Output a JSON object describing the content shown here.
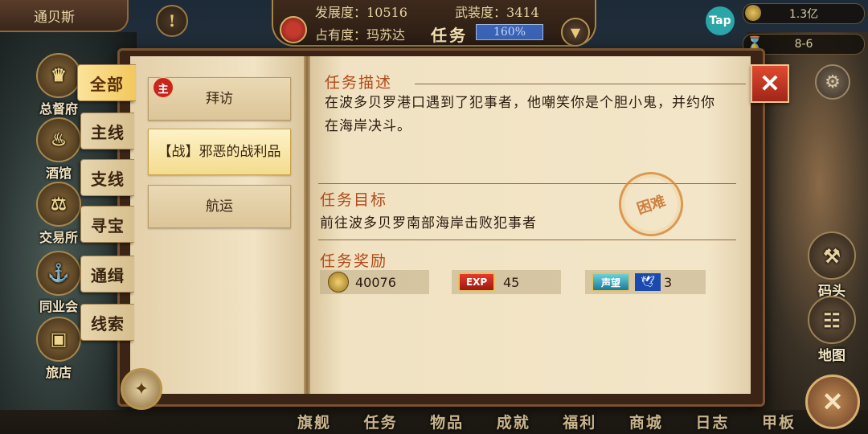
{
  "top_bar": {
    "city_name": "通贝斯",
    "development_label": "发展度：",
    "development_value": "10516",
    "military_label": "武装度：",
    "military_value": "3414",
    "occupancy_label": "占有度：",
    "occupancy_value": "玛苏达",
    "current_screen": "任务",
    "progress_text": "160%",
    "progress_fraction": 1.0,
    "tap_icon": "Tap",
    "currency_value": "1.3亿",
    "date_value": "8-6"
  },
  "left_buildings": [
    {
      "label": "总督府",
      "icon": "crown-icon"
    },
    {
      "label": "酒馆",
      "icon": "chef-icon"
    },
    {
      "label": "交易所",
      "icon": "scales-icon"
    },
    {
      "label": "同业会",
      "icon": "anchor-icon"
    },
    {
      "label": "旅店",
      "icon": "chest-icon"
    }
  ],
  "categories": [
    "全部",
    "主线",
    "支线",
    "寻宝",
    "通缉",
    "线索"
  ],
  "active_category": "全部",
  "quests": [
    {
      "label": "拜访",
      "badge": "主"
    },
    {
      "label": "【战】邪恶的战利品",
      "active": true
    },
    {
      "label": "航运"
    }
  ],
  "detail": {
    "description_title": "任务描述",
    "description_text": "在波多贝罗港口遇到了犯事者，他嘲笑你是个胆小鬼，并约你在海岸决斗。",
    "goal_title": "任务目标",
    "goal_text": "前往波多贝罗南部海岸击败犯事者",
    "difficulty_stamp": "困难",
    "reward_title": "任务奖励",
    "rewards": [
      {
        "icon": "gold-coin-icon",
        "value": "40076"
      },
      {
        "icon": "exp-icon",
        "icon_text": "EXP",
        "value": "45"
      },
      {
        "icon": "reputation-icon",
        "icon_text": "声望",
        "value": "3"
      }
    ]
  },
  "right_buttons": [
    {
      "label": "码头",
      "icon": "dock-icon"
    },
    {
      "label": "地图",
      "icon": "map-scroll-icon"
    }
  ],
  "bottom_nav": [
    "旗舰",
    "任务",
    "物品",
    "成就",
    "福利",
    "商城",
    "日志",
    "甲板"
  ],
  "colors": {
    "accent": "#b04a1a",
    "close_red": "#d0381e",
    "active_tab": "#f2c85c"
  }
}
